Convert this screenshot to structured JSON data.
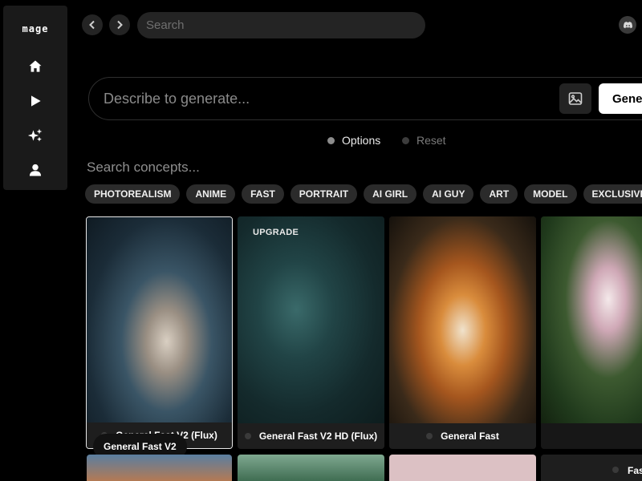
{
  "sidebar": {
    "logo": "mage",
    "items": [
      {
        "name": "home",
        "icon": "home-icon"
      },
      {
        "name": "play",
        "icon": "play-icon"
      },
      {
        "name": "create",
        "icon": "sparkles-icon"
      },
      {
        "name": "profile",
        "icon": "user-icon"
      }
    ]
  },
  "topbar": {
    "search_placeholder": "Search",
    "icons": [
      "chevron-left-icon",
      "chevron-right-icon",
      "discord-icon"
    ]
  },
  "prompt": {
    "placeholder": "Describe to generate...",
    "generate_label": "Generate",
    "image_icon": "image-icon"
  },
  "options": {
    "options_label": "Options",
    "reset_label": "Reset"
  },
  "concepts": {
    "search_placeholder": "Search concepts...",
    "chips": [
      "PHOTOREALISM",
      "ANIME",
      "FAST",
      "PORTRAIT",
      "AI GIRL",
      "AI GUY",
      "ART",
      "MODEL",
      "EXCLUSIVE"
    ]
  },
  "cards": [
    {
      "label": "General Fast V2 (Flux)",
      "selected": true
    },
    {
      "label": "General Fast V2 HD (Flux)",
      "badge": "UPGRADE"
    },
    {
      "label": "General Fast"
    },
    {
      "label": ""
    }
  ],
  "tooltip": "General Fast V2",
  "bottom_row": [
    {
      "label": "Fas"
    }
  ],
  "colors": {
    "background": "#000000",
    "sidebar": "#1a1a1a",
    "surface": "#242424",
    "chip": "#2b2b2b",
    "accent": "#ffffff"
  }
}
